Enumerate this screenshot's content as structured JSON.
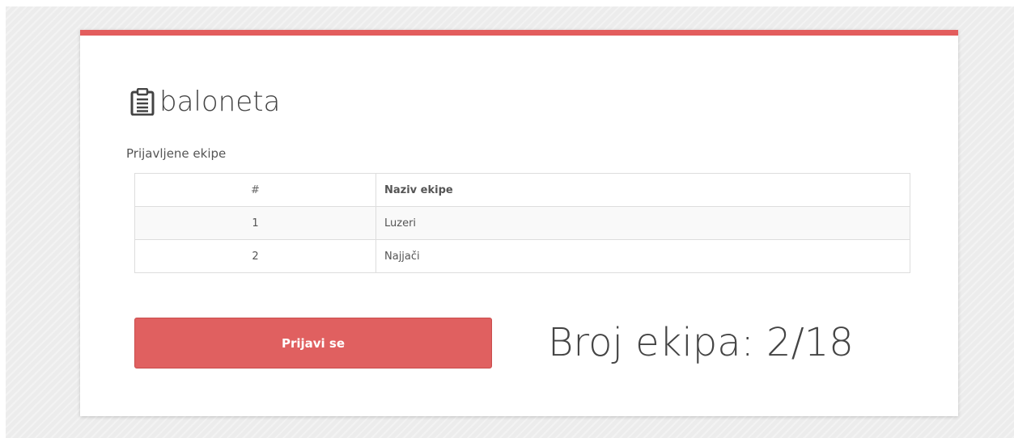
{
  "app": {
    "title": "baloneta",
    "title_icon": "clipboard-icon"
  },
  "teams_section": {
    "label": "Prijavljene ekipe",
    "columns": [
      "#",
      "Naziv ekipe"
    ],
    "rows": [
      {
        "num": "1",
        "name": "Luzeri"
      },
      {
        "num": "2",
        "name": "Najjači"
      }
    ]
  },
  "register_button": {
    "label": "Prijavi se"
  },
  "team_count": {
    "text": "Broj ekipa: 2/18"
  },
  "colors": {
    "accent": "#e35d5d",
    "button": "#e06060",
    "background": "#ececec"
  }
}
